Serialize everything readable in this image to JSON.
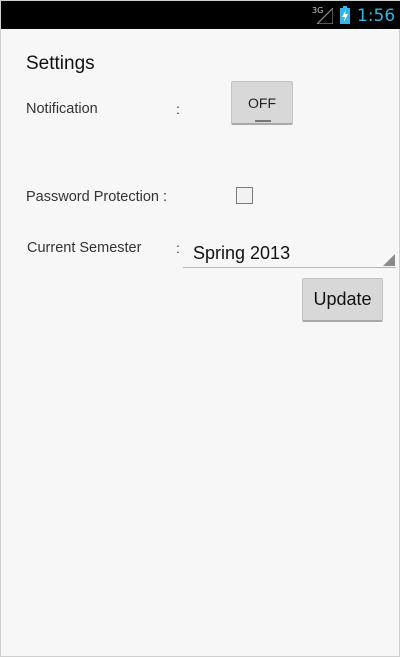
{
  "status_bar": {
    "network": "3G",
    "time": "1:56",
    "icons": [
      "signal-icon",
      "battery-charging-icon"
    ],
    "accent": "#33b5e5"
  },
  "screen": {
    "title": "Settings"
  },
  "settings": {
    "notification": {
      "label": "Notification",
      "separator": ":",
      "toggle_text": "OFF"
    },
    "password_protection": {
      "label": "Password Protection :",
      "checked": false
    },
    "current_semester": {
      "label": "Current Semester",
      "separator": ":",
      "selected": "Spring 2013"
    }
  },
  "actions": {
    "update_label": "Update"
  }
}
